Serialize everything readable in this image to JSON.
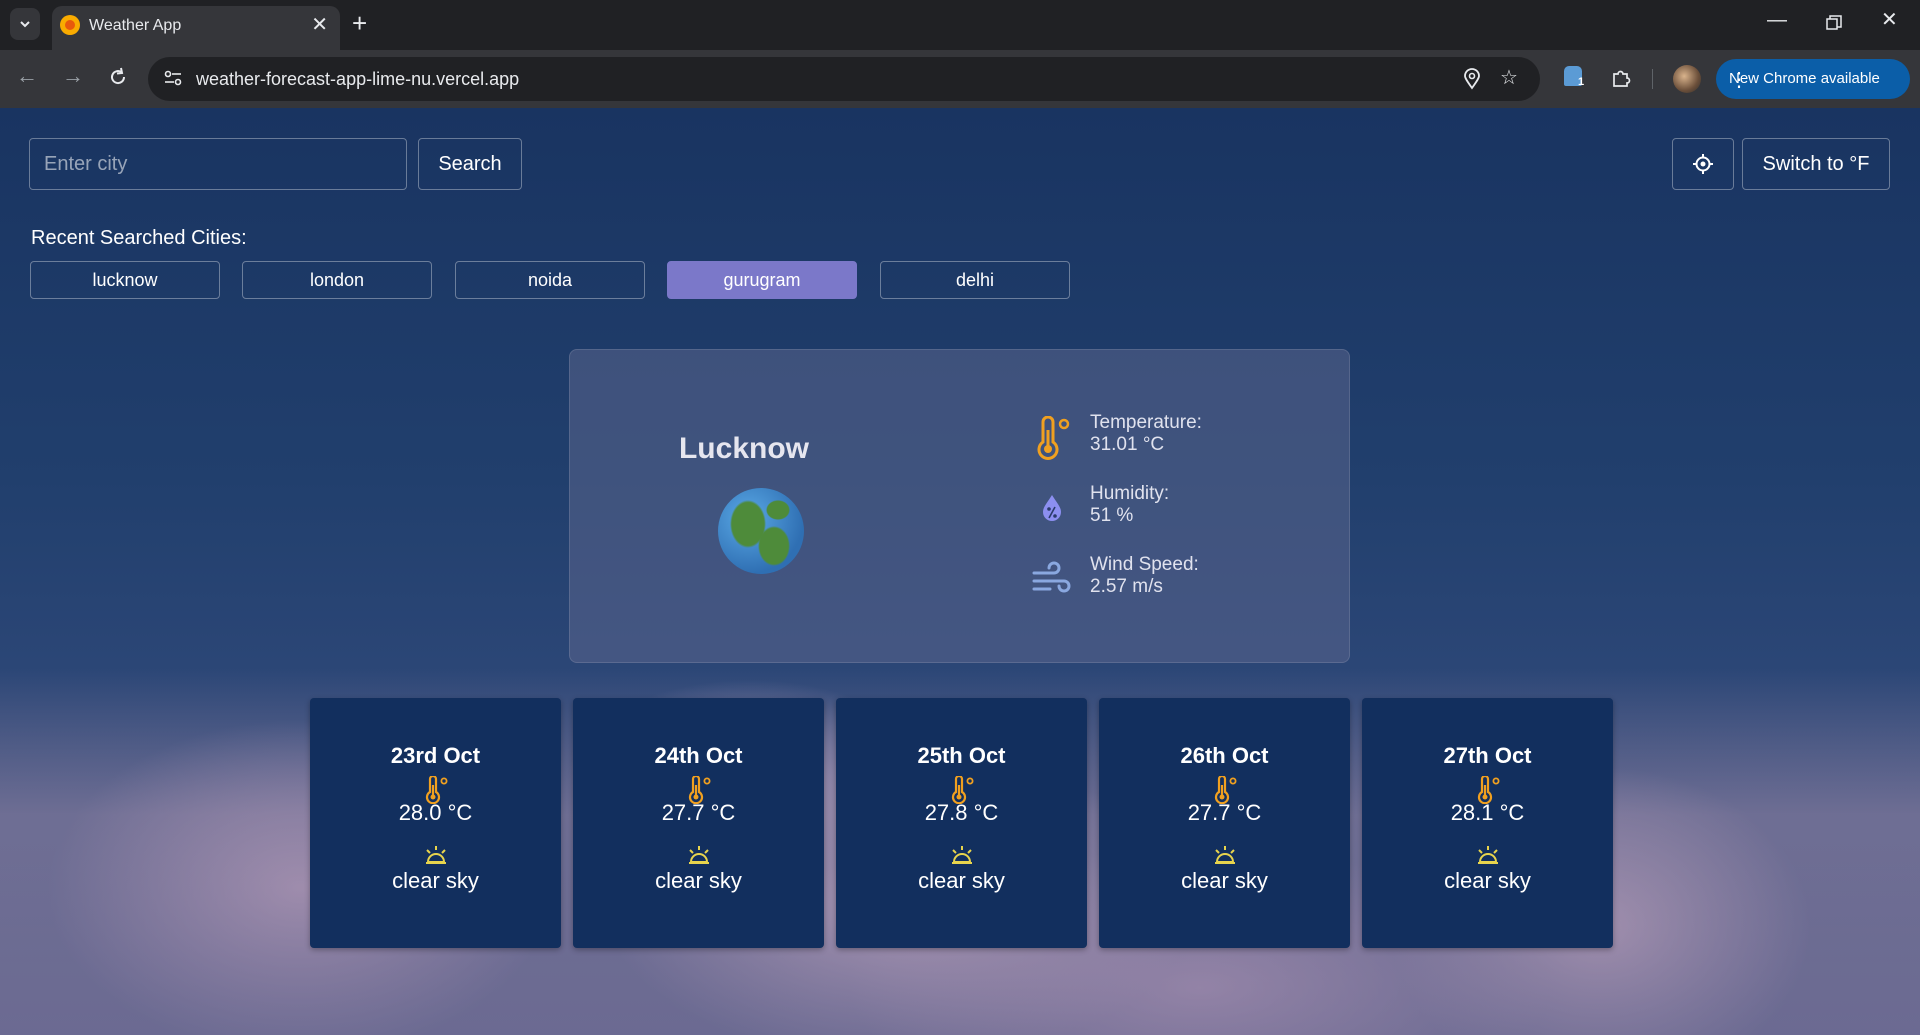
{
  "browser": {
    "tab_title": "Weather App",
    "url": "weather-forecast-app-lime-nu.vercel.app",
    "update_label": "New Chrome available",
    "extension_badge": "1"
  },
  "app": {
    "search": {
      "placeholder": "Enter city",
      "value": "",
      "button_label": "Search"
    },
    "unit_toggle_label": "Switch to °F",
    "recent": {
      "title": "Recent Searched Cities:",
      "cities": [
        "lucknow",
        "london",
        "noida",
        "gurugram",
        "delhi"
      ],
      "active_city": "gurugram"
    },
    "current": {
      "city": "Lucknow",
      "temperature_label": "Temperature:",
      "temperature_value": "31.01 °C",
      "humidity_label": "Humidity:",
      "humidity_value": "51 %",
      "wind_label": "Wind Speed:",
      "wind_value": "2.57 m/s"
    },
    "forecast": [
      {
        "date": "23rd Oct",
        "temp": "28.0 °C",
        "desc": "clear sky"
      },
      {
        "date": "24th Oct",
        "temp": "27.7 °C",
        "desc": "clear sky"
      },
      {
        "date": "25th Oct",
        "temp": "27.8 °C",
        "desc": "clear sky"
      },
      {
        "date": "26th Oct",
        "temp": "27.7 °C",
        "desc": "clear sky"
      },
      {
        "date": "27th Oct",
        "temp": "28.1 °C",
        "desc": "clear sky"
      }
    ]
  },
  "colors": {
    "accent_chip": "#7b78c9",
    "thermometer": "#f0a020",
    "humidity_icon": "#8c8ff0",
    "wind_icon": "#8aa8e0",
    "forecast_card": "#122f5e"
  }
}
